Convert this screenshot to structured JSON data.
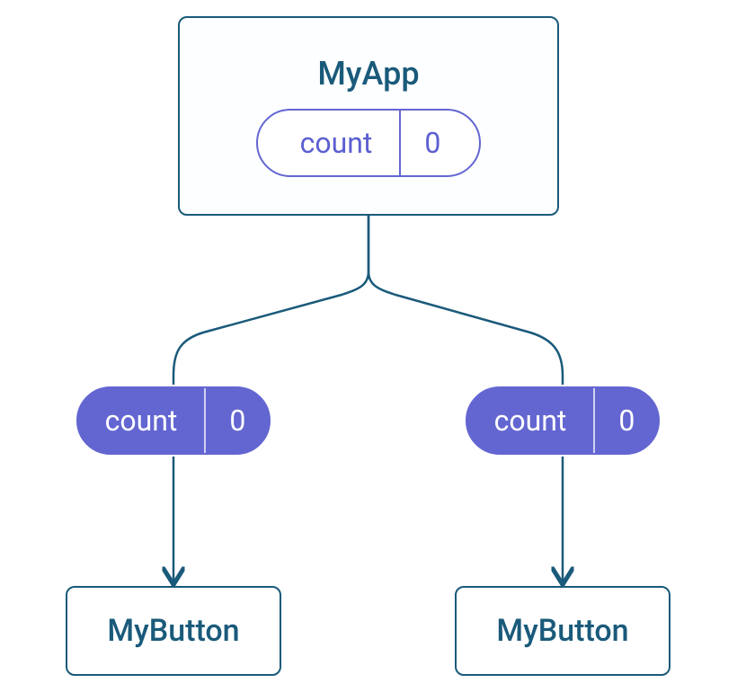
{
  "root": {
    "title": "MyApp",
    "state": {
      "label": "count",
      "value": "0"
    }
  },
  "children": [
    {
      "props": {
        "label": "count",
        "value": "0"
      },
      "title": "MyButton"
    },
    {
      "props": {
        "label": "count",
        "value": "0"
      },
      "title": "MyButton"
    }
  ]
}
